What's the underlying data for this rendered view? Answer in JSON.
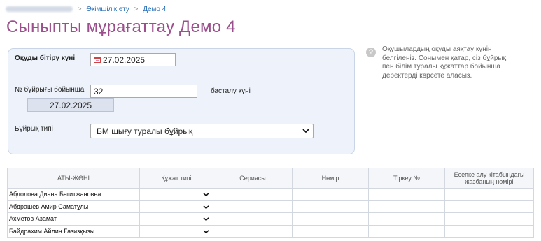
{
  "breadcrumb": {
    "items": [
      "Әкімшілік ету",
      "Демо 4"
    ]
  },
  "page_title": "Сыныпты мұрағаттау Демо 4",
  "form": {
    "graduation_date_label": "Оқуды бітіру күні",
    "graduation_date_value": "27.02.2025",
    "order_number_label": "№ бұйрығы бойынша",
    "order_number_value": "32",
    "start_date_label": "басталу күні",
    "start_date_value": "27.02.2025",
    "order_type_label": "Бұйрық типі",
    "order_type_value": "БМ шығу туралы бұйрық"
  },
  "info_text": "Оқушылардың оқуды аяқтау күнін белгіленіз. Сонымен қатар, сіз бұйрық пен білім туралы құжаттар бойынша деректерді көрсете аласыз.",
  "table": {
    "headers": [
      "АТЫ-ЖӨНІ",
      "Құжат типі",
      "Сериясы",
      "Нөмір",
      "Тіркеу №",
      "Есепке алу кітабындағы жазбаның нөмірі"
    ],
    "rows": [
      {
        "name": "Абдолова Диана Багитжановна"
      },
      {
        "name": "Абдрашев Амир Саматұлы"
      },
      {
        "name": "Ахметов Азамат"
      },
      {
        "name": "Байдрахим Айлин Ғазизқызы"
      }
    ]
  },
  "colors": {
    "title": "#9b4f8c",
    "link": "#2a6fb8",
    "panel_bg": "#eef3fb"
  },
  "icons": {
    "calendar": "calendar-icon",
    "info": "info-icon",
    "dropdown": "chevron-down-icon"
  }
}
